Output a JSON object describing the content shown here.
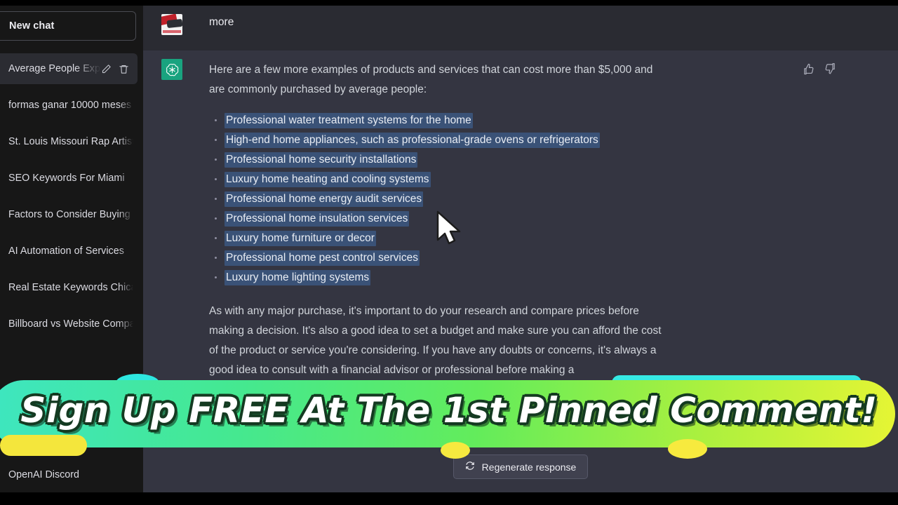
{
  "sidebar": {
    "new_chat_label": "New chat",
    "items": [
      {
        "label": "Average People Expen",
        "active": true,
        "icons": [
          "edit-icon",
          "trash-icon"
        ]
      },
      {
        "label": "formas ganar 10000 meses",
        "active": false
      },
      {
        "label": "St. Louis Missouri Rap Artists",
        "active": false
      },
      {
        "label": "SEO Keywords For Miami",
        "active": false
      },
      {
        "label": "Factors to Consider Buying S",
        "active": false
      },
      {
        "label": "AI Automation of Services",
        "active": false
      },
      {
        "label": "Real Estate Keywords Chicago",
        "active": false
      },
      {
        "label": "Billboard vs Website Compari",
        "active": false
      }
    ],
    "bottom_item": "OpenAI Discord"
  },
  "conversation": {
    "user_message": {
      "text": "more",
      "avatar": "user-photo-avatar"
    },
    "assistant_message": {
      "avatar": "chatgpt-logo",
      "intro_paragraph": "Here are a few more examples of products and services that can cost more than $5,000 and are commonly purchased by average people:",
      "bullets": [
        "Professional water treatment systems for the home",
        "High-end home appliances, such as professional-grade ovens or refrigerators",
        "Professional home security installations",
        "Luxury home heating and cooling systems",
        "Professional home energy audit services",
        "Professional home insulation services",
        "Luxury home furniture or decor",
        "Professional home pest control services",
        "Luxury home lighting systems"
      ],
      "closing_paragraph": "As with any major purchase, it's important to do your research and compare prices before making a decision. It's also a good idea to set a budget and make sure you can afford the cost of the product or service you're considering. If you have any doubts or concerns, it's always a good idea to consult with a financial advisor or professional before making a",
      "feedback_icons": [
        "thumbs-up-icon",
        "thumbs-down-icon"
      ]
    }
  },
  "footer": {
    "regenerate_label": "Regenerate response",
    "regenerate_icon": "refresh-icon"
  },
  "promo_banner": {
    "text": "Sign Up FREE At The 1st Pinned Comment!",
    "gradient_start": "#3ee6c0",
    "gradient_mid": "#63ec5b",
    "gradient_end": "#e6f534",
    "text_color": "#ffffff",
    "outline_color": "#143a21",
    "accent_cyan": "#36e9e3",
    "accent_yellow": "#f7ea3e"
  },
  "theme": {
    "sidebar_bg": "#171717",
    "main_bg": "#343541",
    "user_row_bg": "#2a2b32",
    "selection_bg": "#3a5277",
    "brand_green": "#19a37f",
    "text_primary": "#ececf1",
    "text_body": "#d1d5db"
  }
}
